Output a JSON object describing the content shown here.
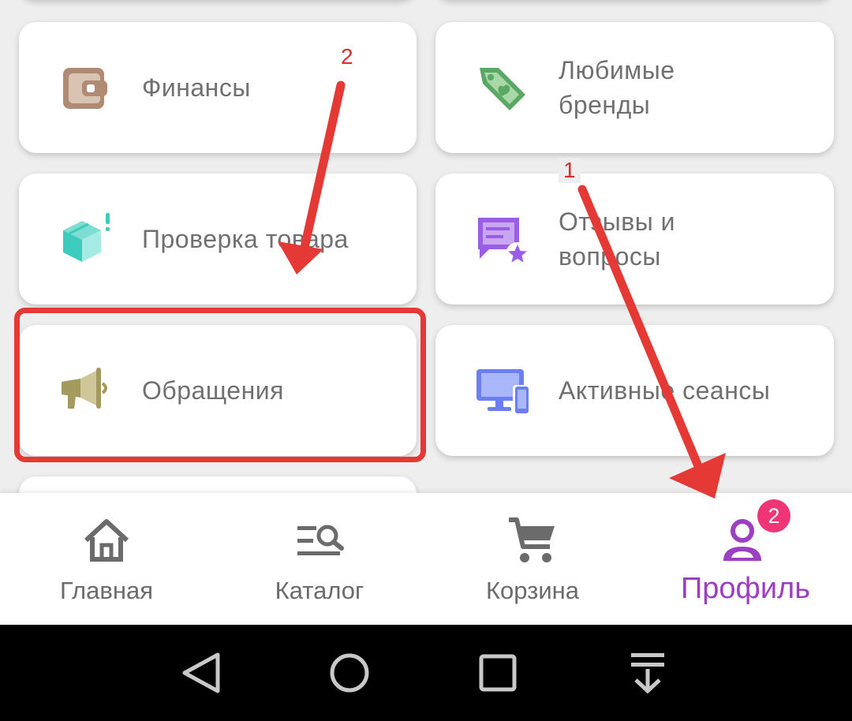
{
  "cards": [
    {
      "id": "finances",
      "label": "Финансы",
      "icon": "wallet-icon",
      "color": "#b08a72"
    },
    {
      "id": "favorite-brands",
      "label": "Любимые\nбренды",
      "icon": "tag-heart-icon",
      "color": "#5aa864"
    },
    {
      "id": "product-check",
      "label": "Проверка товара",
      "icon": "box-check-icon",
      "color": "#3ccbbd"
    },
    {
      "id": "reviews",
      "label": "Отзывы и\nвопросы",
      "icon": "chat-star-icon",
      "color": "#9b5de5"
    },
    {
      "id": "appeals",
      "label": "Обращения",
      "icon": "megaphone-icon",
      "color": "#a49a5e"
    },
    {
      "id": "active-sessions",
      "label": "Активные сеансы",
      "icon": "devices-icon",
      "color": "#6b7ff0"
    }
  ],
  "annotations": {
    "step1": "1",
    "step2": "2",
    "highlight_color": "#e53935"
  },
  "nav": {
    "items": [
      {
        "id": "home",
        "label": "Главная",
        "icon": "home-icon"
      },
      {
        "id": "catalog",
        "label": "Каталог",
        "icon": "catalog-search-icon"
      },
      {
        "id": "cart",
        "label": "Корзина",
        "icon": "cart-icon"
      },
      {
        "id": "profile",
        "label": "Профиль",
        "icon": "profile-icon",
        "active": true
      }
    ],
    "profile_badge": "2",
    "active_color": "#9c3fc2"
  },
  "system_nav": [
    "back-icon",
    "home-circle-icon",
    "recents-icon",
    "notification-pulldown-icon"
  ]
}
